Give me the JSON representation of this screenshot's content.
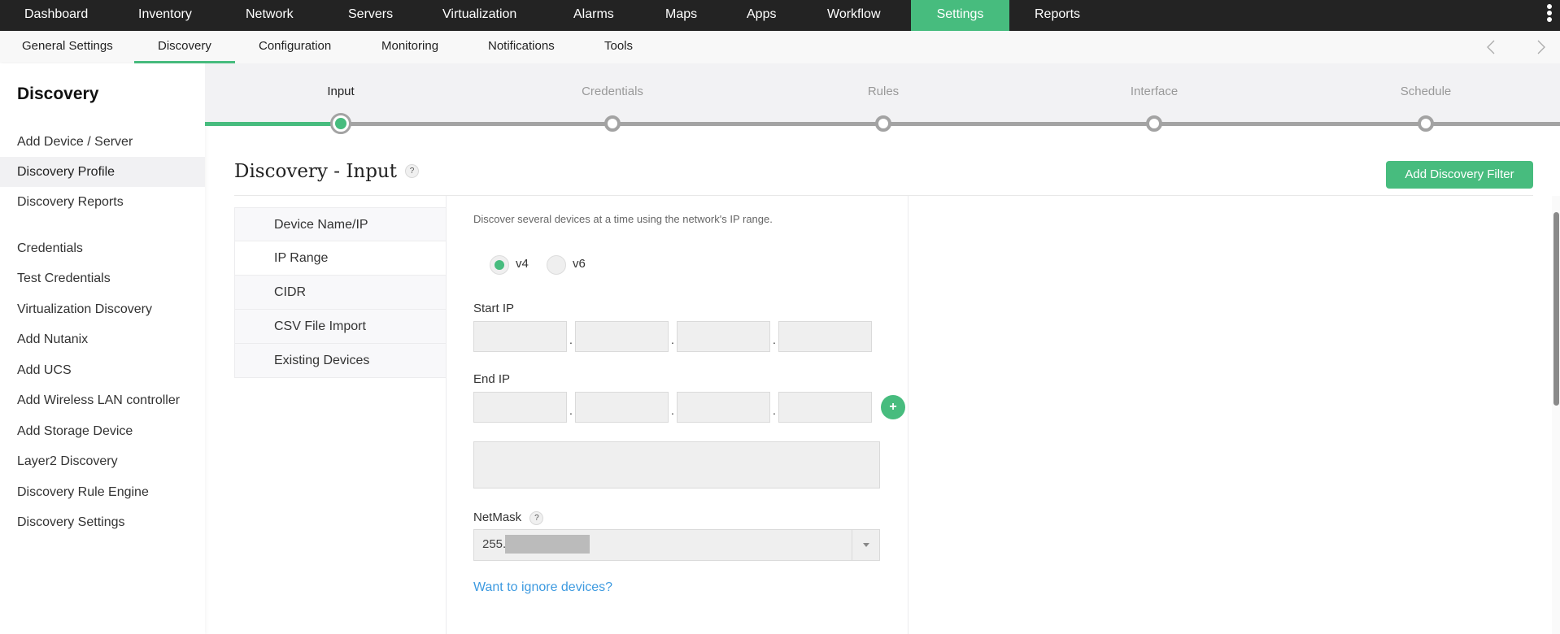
{
  "colors": {
    "accent": "#47bc7e",
    "topnav_bg": "#232323",
    "link": "#3d9ae0"
  },
  "topnav": {
    "items": [
      "Dashboard",
      "Inventory",
      "Network",
      "Servers",
      "Virtualization",
      "Alarms",
      "Maps",
      "Apps",
      "Workflow",
      "Settings",
      "Reports"
    ],
    "active": "Settings",
    "more_icon": "kebab-menu-icon"
  },
  "subnav": {
    "items": [
      "General Settings",
      "Discovery",
      "Configuration",
      "Monitoring",
      "Notifications",
      "Tools"
    ],
    "active": "Discovery",
    "prev_icon": "chevron-left-icon",
    "next_icon": "chevron-right-icon"
  },
  "sidebar": {
    "title": "Discovery",
    "items": [
      "Add Device / Server",
      "Discovery Profile",
      "Discovery Reports",
      "Credentials",
      "Test Credentials",
      "Virtualization Discovery",
      "Add Nutanix",
      "Add UCS",
      "Add Wireless LAN controller",
      "Add Storage Device",
      "Layer2 Discovery",
      "Discovery Rule Engine",
      "Discovery Settings"
    ],
    "active": "Discovery Profile"
  },
  "stepper": {
    "steps": [
      "Input",
      "Credentials",
      "Rules",
      "Interface",
      "Schedule"
    ],
    "current": "Input"
  },
  "main": {
    "title": "Discovery - Input",
    "help": "?",
    "add_filter_button": "Add Discovery Filter",
    "input_types": [
      "Device Name/IP",
      "IP Range",
      "CIDR",
      "CSV File Import",
      "Existing Devices"
    ],
    "active_input_type": "IP Range",
    "description": "Discover several devices at a time using the network's IP range.",
    "ip_version": {
      "options": [
        "v4",
        "v6"
      ],
      "selected": "v4"
    },
    "start_ip": {
      "label": "Start IP",
      "octets": [
        "",
        "",
        "",
        ""
      ],
      "separator": "."
    },
    "end_ip": {
      "label": "End IP",
      "octets": [
        "",
        "",
        "",
        ""
      ],
      "separator": ".",
      "add_button": "+"
    },
    "ip_list_value": "",
    "netmask": {
      "label": "NetMask",
      "help": "?",
      "value": "255."
    },
    "ignore_link": "Want to ignore devices?"
  }
}
